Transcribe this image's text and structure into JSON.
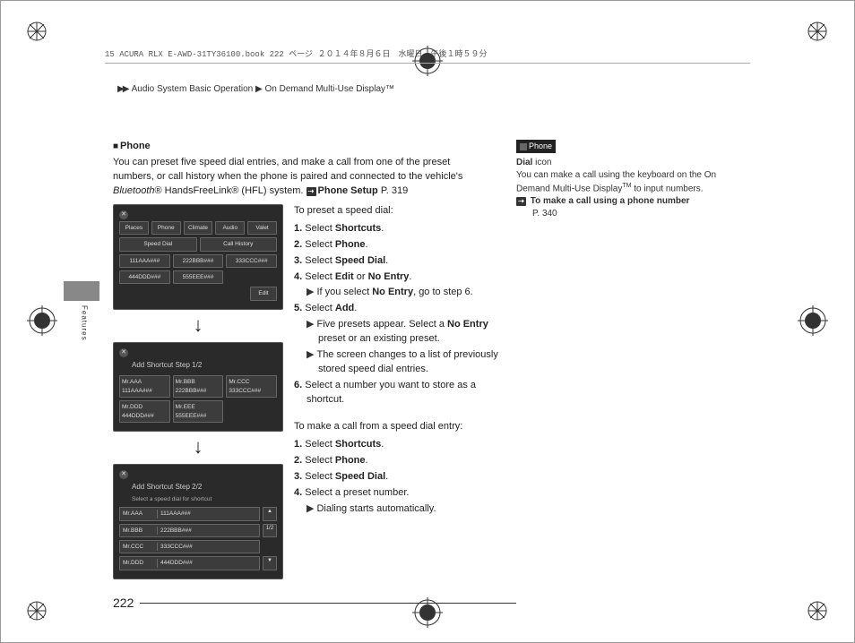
{
  "header_line": "15 ACURA RLX E-AWD-31TY36100.book  222 ページ  ２０１４年８月６日　水曜日　午後１時５９分",
  "breadcrumb": {
    "arrows": "▶▶",
    "seg1": "Audio System Basic Operation",
    "seg2": "On Demand Multi-Use Display™"
  },
  "tab_label": "Features",
  "page_number": "222",
  "section_title": "Phone",
  "intro": {
    "line1": "You can preset five speed dial entries, and make a call from one of the preset",
    "line2": "numbers, or call history when the phone is paired and connected to the vehicle's",
    "line3_pre": "Bluetooth",
    "line3_mid": "® HandsFreeLink® (HFL) system. ",
    "xref_label": "Phone Setup",
    "xref_page": "P. 319"
  },
  "preset_intro": "To preset a speed dial:",
  "steps_preset": [
    {
      "n": "1.",
      "pre": "Select ",
      "b": "Shortcuts",
      "post": "."
    },
    {
      "n": "2.",
      "pre": "Select ",
      "b": "Phone",
      "post": "."
    },
    {
      "n": "3.",
      "pre": "Select ",
      "b": "Speed Dial",
      "post": "."
    },
    {
      "n": "4.",
      "pre": "Select ",
      "b": "Edit",
      "mid": " or ",
      "b2": "No Entry",
      "post": "."
    }
  ],
  "sub4": {
    "pre": "If you select ",
    "b": "No Entry",
    "post": ", go to step 6."
  },
  "step5": {
    "n": "5.",
    "pre": "Select ",
    "b": "Add",
    "post": "."
  },
  "sub5a": {
    "pre": "Five presets appear. Select a ",
    "b": "No Entry",
    "post1": "",
    "post2": "preset or an existing preset."
  },
  "sub5b": {
    "line1": "The screen changes to a list of previously",
    "line2": "stored speed dial entries."
  },
  "step6": {
    "n": "6.",
    "line1": "Select a number you want to store as a",
    "line2": "shortcut."
  },
  "call_intro": "To make a call from a speed dial entry:",
  "steps_call": [
    {
      "n": "1.",
      "pre": "Select ",
      "b": "Shortcuts",
      "post": "."
    },
    {
      "n": "2.",
      "pre": "Select ",
      "b": "Phone",
      "post": "."
    },
    {
      "n": "3.",
      "pre": "Select ",
      "b": "Speed Dial",
      "post": "."
    },
    {
      "n": "4.",
      "pre": "Select a preset number.",
      "b": "",
      "post": ""
    }
  ],
  "sub_call": {
    "text": "Dialing starts automatically."
  },
  "sidebar": {
    "hdr": "Phone",
    "l1_b": "Dial",
    "l1_rest": " icon",
    "l2": "You can make a call using the keyboard on the On",
    "l3": "Demand Multi-Use Display",
    "l3_sup": "TM",
    "l3_end": " to input numbers.",
    "xref": "To make a call using a phone number",
    "xref_pg": "P. 340"
  },
  "screens": {
    "s1": {
      "tabs": [
        "Places",
        "Phone",
        "Climate",
        "Audio",
        "Valet"
      ],
      "row1": [
        "Speed Dial",
        "Call History"
      ],
      "row2": [
        "111AAA###",
        "222BBB###",
        "333CCC###"
      ],
      "row3": [
        "444DDD###",
        "555EEE###"
      ],
      "edit": "Edit"
    },
    "s2": {
      "title": "Add Shortcut  Step 1/2",
      "r1": [
        {
          "a": "Mr.AAA",
          "b": "111AAA###"
        },
        {
          "a": "Mr.BBB",
          "b": "222BBB###"
        },
        {
          "a": "Mr.CCC",
          "b": "333CCC###"
        }
      ],
      "r2": [
        {
          "a": "Mr.DDD",
          "b": "444DDD###"
        },
        {
          "a": "Mr.EEE",
          "b": "555EEE###"
        }
      ]
    },
    "s3": {
      "title": "Add Shortcut  Step 2/2",
      "sub": "Select a speed dial for shortcut",
      "rows": [
        {
          "a": "Mr.AAA",
          "b": "111AAA###"
        },
        {
          "a": "Mr.BBB",
          "b": "222BBB###"
        },
        {
          "a": "Mr.CCC",
          "b": "333CCC###"
        },
        {
          "a": "Mr.DDD",
          "b": "444DDD###"
        }
      ],
      "nav": "1/2"
    }
  }
}
